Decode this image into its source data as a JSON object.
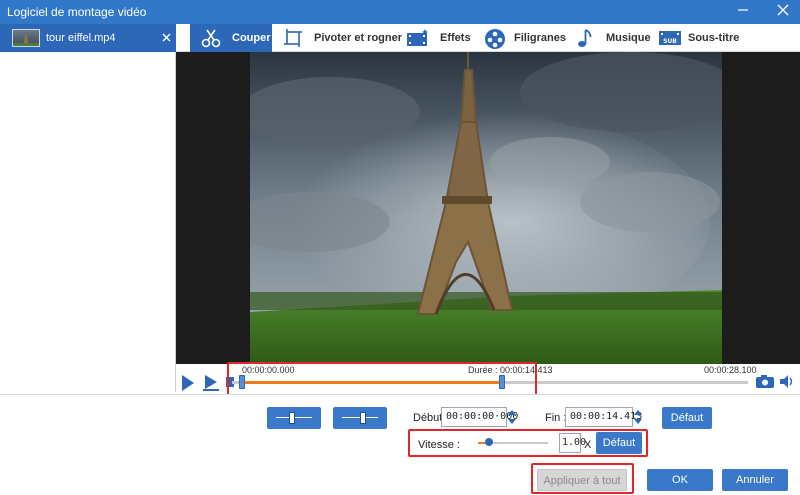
{
  "window": {
    "title": "Logiciel de montage vidéo"
  },
  "sidebar": {
    "file_name": "tour eiffel.mp4"
  },
  "tabs": [
    {
      "label": "Couper",
      "icon": "scissors-icon",
      "active": true
    },
    {
      "label": "Pivoter et rogner",
      "icon": "crop-rotate-icon",
      "active": false
    },
    {
      "label": "Effets",
      "icon": "effects-icon",
      "active": false
    },
    {
      "label": "Filigranes",
      "icon": "watermark-icon",
      "active": false
    },
    {
      "label": "Musique",
      "icon": "music-icon",
      "active": false
    },
    {
      "label": "Sous-titre",
      "icon": "subtitle-icon",
      "active": false
    }
  ],
  "timeline": {
    "start_label": "00:00:00.000",
    "duration_label": "Durée : 00:00:14.413",
    "end_label": "00:00:28.100"
  },
  "trim": {
    "start_label": "Début",
    "start_value": "00:00:00·000",
    "end_label": "Fin :",
    "end_value": "00:00:14.413",
    "default_label": "Défaut"
  },
  "speed": {
    "label": "Vitesse :",
    "value": "1.00",
    "unit": "X",
    "default_label": "Défaut"
  },
  "footer": {
    "apply_all_label": "Appliquer à tout",
    "ok_label": "OK",
    "cancel_label": "Annuler"
  },
  "colors": {
    "accent": "#2c67b8",
    "orange": "#f07c1e",
    "highlight_red": "#e3262a"
  }
}
